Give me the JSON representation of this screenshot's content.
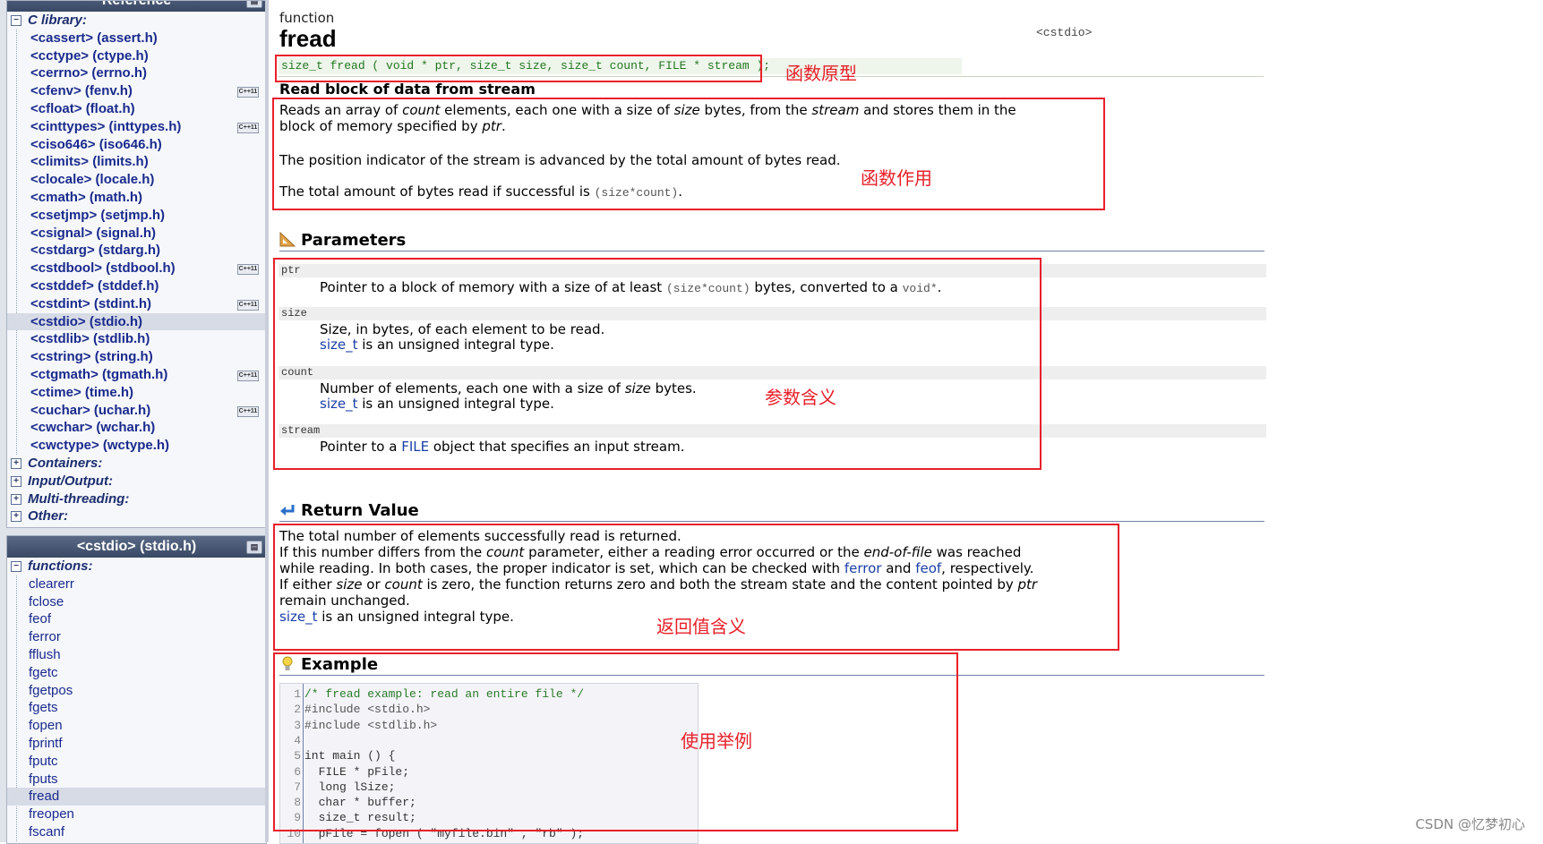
{
  "sidebar": {
    "library_title": "Reference",
    "c_library_label": "C library:",
    "headers": [
      {
        "label": "<cassert> (assert.h)",
        "badge": ""
      },
      {
        "label": "<cctype> (ctype.h)",
        "badge": ""
      },
      {
        "label": "<cerrno> (errno.h)",
        "badge": ""
      },
      {
        "label": "<cfenv> (fenv.h)",
        "badge": "C++11"
      },
      {
        "label": "<cfloat> (float.h)",
        "badge": ""
      },
      {
        "label": "<cinttypes> (inttypes.h)",
        "badge": "C++11"
      },
      {
        "label": "<ciso646> (iso646.h)",
        "badge": ""
      },
      {
        "label": "<climits> (limits.h)",
        "badge": ""
      },
      {
        "label": "<clocale> (locale.h)",
        "badge": ""
      },
      {
        "label": "<cmath> (math.h)",
        "badge": ""
      },
      {
        "label": "<csetjmp> (setjmp.h)",
        "badge": ""
      },
      {
        "label": "<csignal> (signal.h)",
        "badge": ""
      },
      {
        "label": "<cstdarg> (stdarg.h)",
        "badge": ""
      },
      {
        "label": "<cstdbool> (stdbool.h)",
        "badge": "C++11"
      },
      {
        "label": "<cstddef> (stddef.h)",
        "badge": ""
      },
      {
        "label": "<cstdint> (stdint.h)",
        "badge": "C++11"
      },
      {
        "label": "<cstdio> (stdio.h)",
        "badge": "",
        "selected": true
      },
      {
        "label": "<cstdlib> (stdlib.h)",
        "badge": ""
      },
      {
        "label": "<cstring> (string.h)",
        "badge": ""
      },
      {
        "label": "<ctgmath> (tgmath.h)",
        "badge": "C++11"
      },
      {
        "label": "<ctime> (time.h)",
        "badge": ""
      },
      {
        "label": "<cuchar> (uchar.h)",
        "badge": "C++11"
      },
      {
        "label": "<cwchar> (wchar.h)",
        "badge": ""
      },
      {
        "label": "<cwctype> (wctype.h)",
        "badge": ""
      }
    ],
    "groups": [
      "Containers:",
      "Input/Output:",
      "Multi-threading:",
      "Other:"
    ],
    "header_panel_title": "<cstdio> (stdio.h)",
    "functions_label": "functions:",
    "functions": [
      "clearerr",
      "fclose",
      "feof",
      "ferror",
      "fflush",
      "fgetc",
      "fgetpos",
      "fgets",
      "fopen",
      "fprintf",
      "fputc",
      "fputs",
      "fread",
      "freopen",
      "fscanf"
    ],
    "selected_function": "fread"
  },
  "main": {
    "kind": "function",
    "name": "fread",
    "header": "<cstdio>",
    "prototype": "size_t fread ( void * ptr, size_t size, size_t count, FILE * stream );",
    "subtitle": "Read block of data from stream",
    "desc1_a": "Reads an array of ",
    "desc1_count": "count",
    "desc1_b": " elements, each one with a size of ",
    "desc1_size": "size",
    "desc1_c": " bytes, from the ",
    "desc1_stream": "stream",
    "desc1_d": " and stores them in the block of memory specified by ",
    "desc1_ptr": "ptr",
    "desc1_e": ".",
    "desc2": "The position indicator of the stream is advanced by the total amount of bytes read.",
    "desc3_a": "The total amount of bytes read if successful is ",
    "desc3_code": "(size*count)",
    "desc3_b": ".",
    "parameters_title": "Parameters",
    "params": {
      "ptr_name": "ptr",
      "ptr_a": "Pointer to a block of memory with a size of at least ",
      "ptr_code": "(size*count)",
      "ptr_b": " bytes, converted to a ",
      "ptr_code2": "void*",
      "ptr_c": ".",
      "size_name": "size",
      "size_line1": "Size, in bytes, of each element to be read.",
      "size_link": "size_t",
      "size_line2": " is an unsigned integral type.",
      "count_name": "count",
      "count_a": "Number of elements, each one with a size of ",
      "count_size": "size",
      "count_b": " bytes.",
      "count_link": "size_t",
      "count_line2": " is an unsigned integral type.",
      "stream_name": "stream",
      "stream_a": "Pointer to a ",
      "stream_link": "FILE",
      "stream_b": " object that specifies an input stream."
    },
    "return_title": "Return Value",
    "ret": {
      "line1": "The total number of elements successfully read is returned.",
      "line2_a": "If this number differs from the ",
      "line2_count": "count",
      "line2_b": " parameter, either a reading error occurred or the ",
      "line2_eof": "end-of-file",
      "line2_c": " was reached while reading. In both cases, the proper indicator is set, which can be checked with ",
      "line2_ferror": "ferror",
      "line2_d": " and ",
      "line2_feof": "feof",
      "line2_e": ", respectively.",
      "line3_a": "If either ",
      "line3_size": "size",
      "line3_b": " or ",
      "line3_count": "count",
      "line3_c": " is zero, the function returns zero and both the stream state and the content pointed by ",
      "line3_ptr": "ptr",
      "line3_d": " remain unchanged.",
      "line4_link": "size_t",
      "line4": " is an unsigned integral type."
    },
    "example_title": "Example",
    "code_lines": [
      {
        "n": "1",
        "t": "/* fread example: read an entire file */"
      },
      {
        "n": "2",
        "t": "#include <stdio.h>"
      },
      {
        "n": "3",
        "t": "#include <stdlib.h>"
      },
      {
        "n": "4",
        "t": ""
      },
      {
        "n": "5",
        "t": "int main () {"
      },
      {
        "n": "6",
        "t": "  FILE * pFile;"
      },
      {
        "n": "7",
        "t": "  long lSize;"
      },
      {
        "n": "8",
        "t": "  char * buffer;"
      },
      {
        "n": "9",
        "t": "  size_t result;"
      },
      {
        "n": "10",
        "t": "  pFile = fopen ( \"myfile.bin\" , \"rb\" );"
      }
    ]
  },
  "annotations": {
    "prototype_note": "函数原型",
    "purpose_note": "函数作用",
    "params_note": "参数含义",
    "return_note": "返回值含义",
    "example_note": "使用举例",
    "color": "#e8202a"
  },
  "watermark": "CSDN @忆梦初心"
}
